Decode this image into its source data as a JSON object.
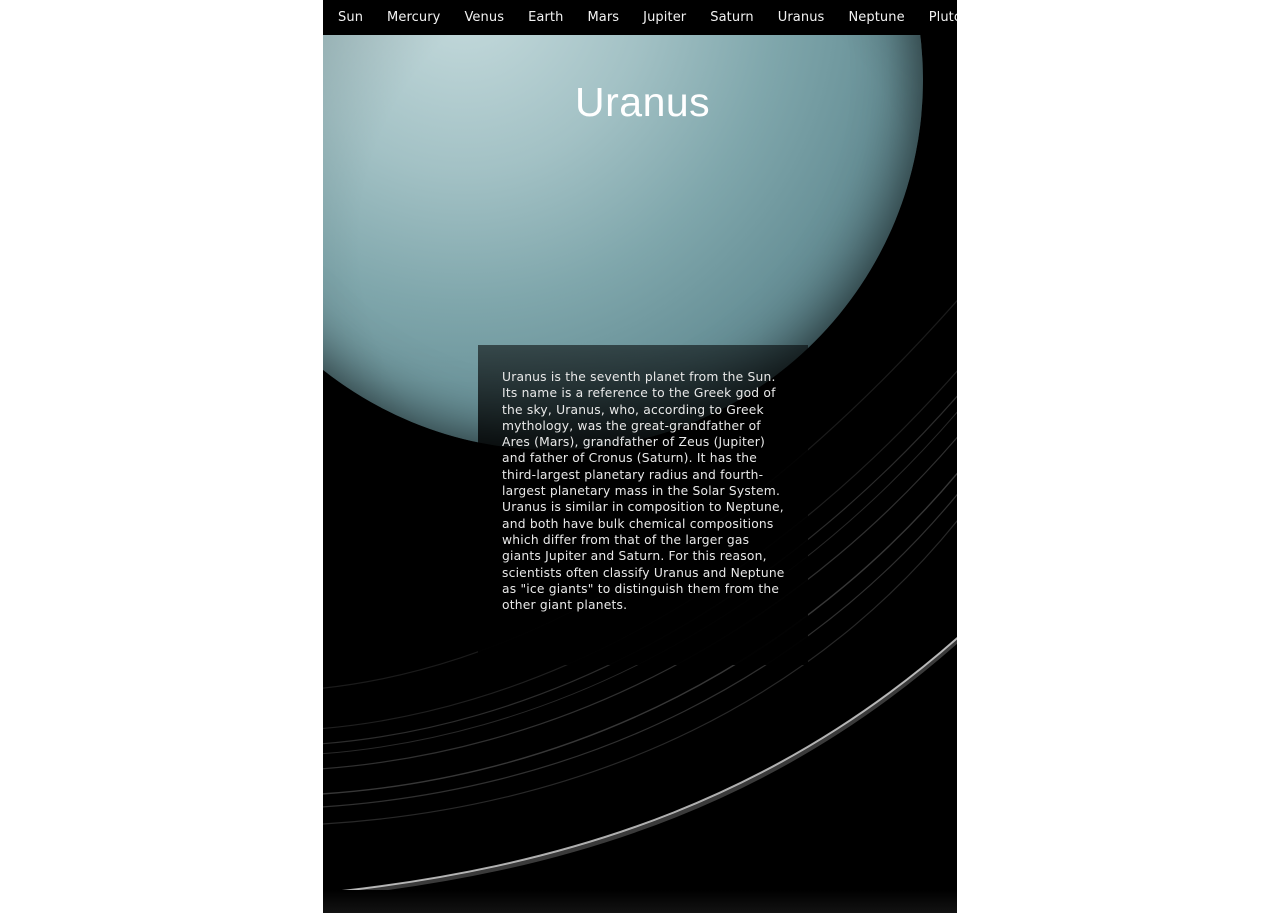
{
  "nav": {
    "items": [
      {
        "label": "Sun"
      },
      {
        "label": "Mercury"
      },
      {
        "label": "Venus"
      },
      {
        "label": "Earth"
      },
      {
        "label": "Mars"
      },
      {
        "label": "Jupiter"
      },
      {
        "label": "Saturn"
      },
      {
        "label": "Uranus"
      },
      {
        "label": "Neptune"
      },
      {
        "label": "Pluto"
      }
    ]
  },
  "hero": {
    "title": "Uranus",
    "description": "Uranus is the seventh planet from the Sun. Its name is a reference to the Greek god of the sky, Uranus, who, according to Greek mythology, was the great-grandfather of Ares (Mars), grandfather of Zeus (Jupiter) and father of Cronus (Saturn). It has the third-largest planetary radius and fourth-largest planetary mass in the Solar System. Uranus is similar in composition to Neptune, and both have bulk chemical compositions which differ from that of the larger gas giants Jupiter and Saturn. For this reason, scientists often classify Uranus and Neptune as \"ice giants\" to distinguish them from the other giant planets."
  },
  "colors": {
    "background": "#000000",
    "text": "#ffffff",
    "planet": "#9ec6cb"
  }
}
